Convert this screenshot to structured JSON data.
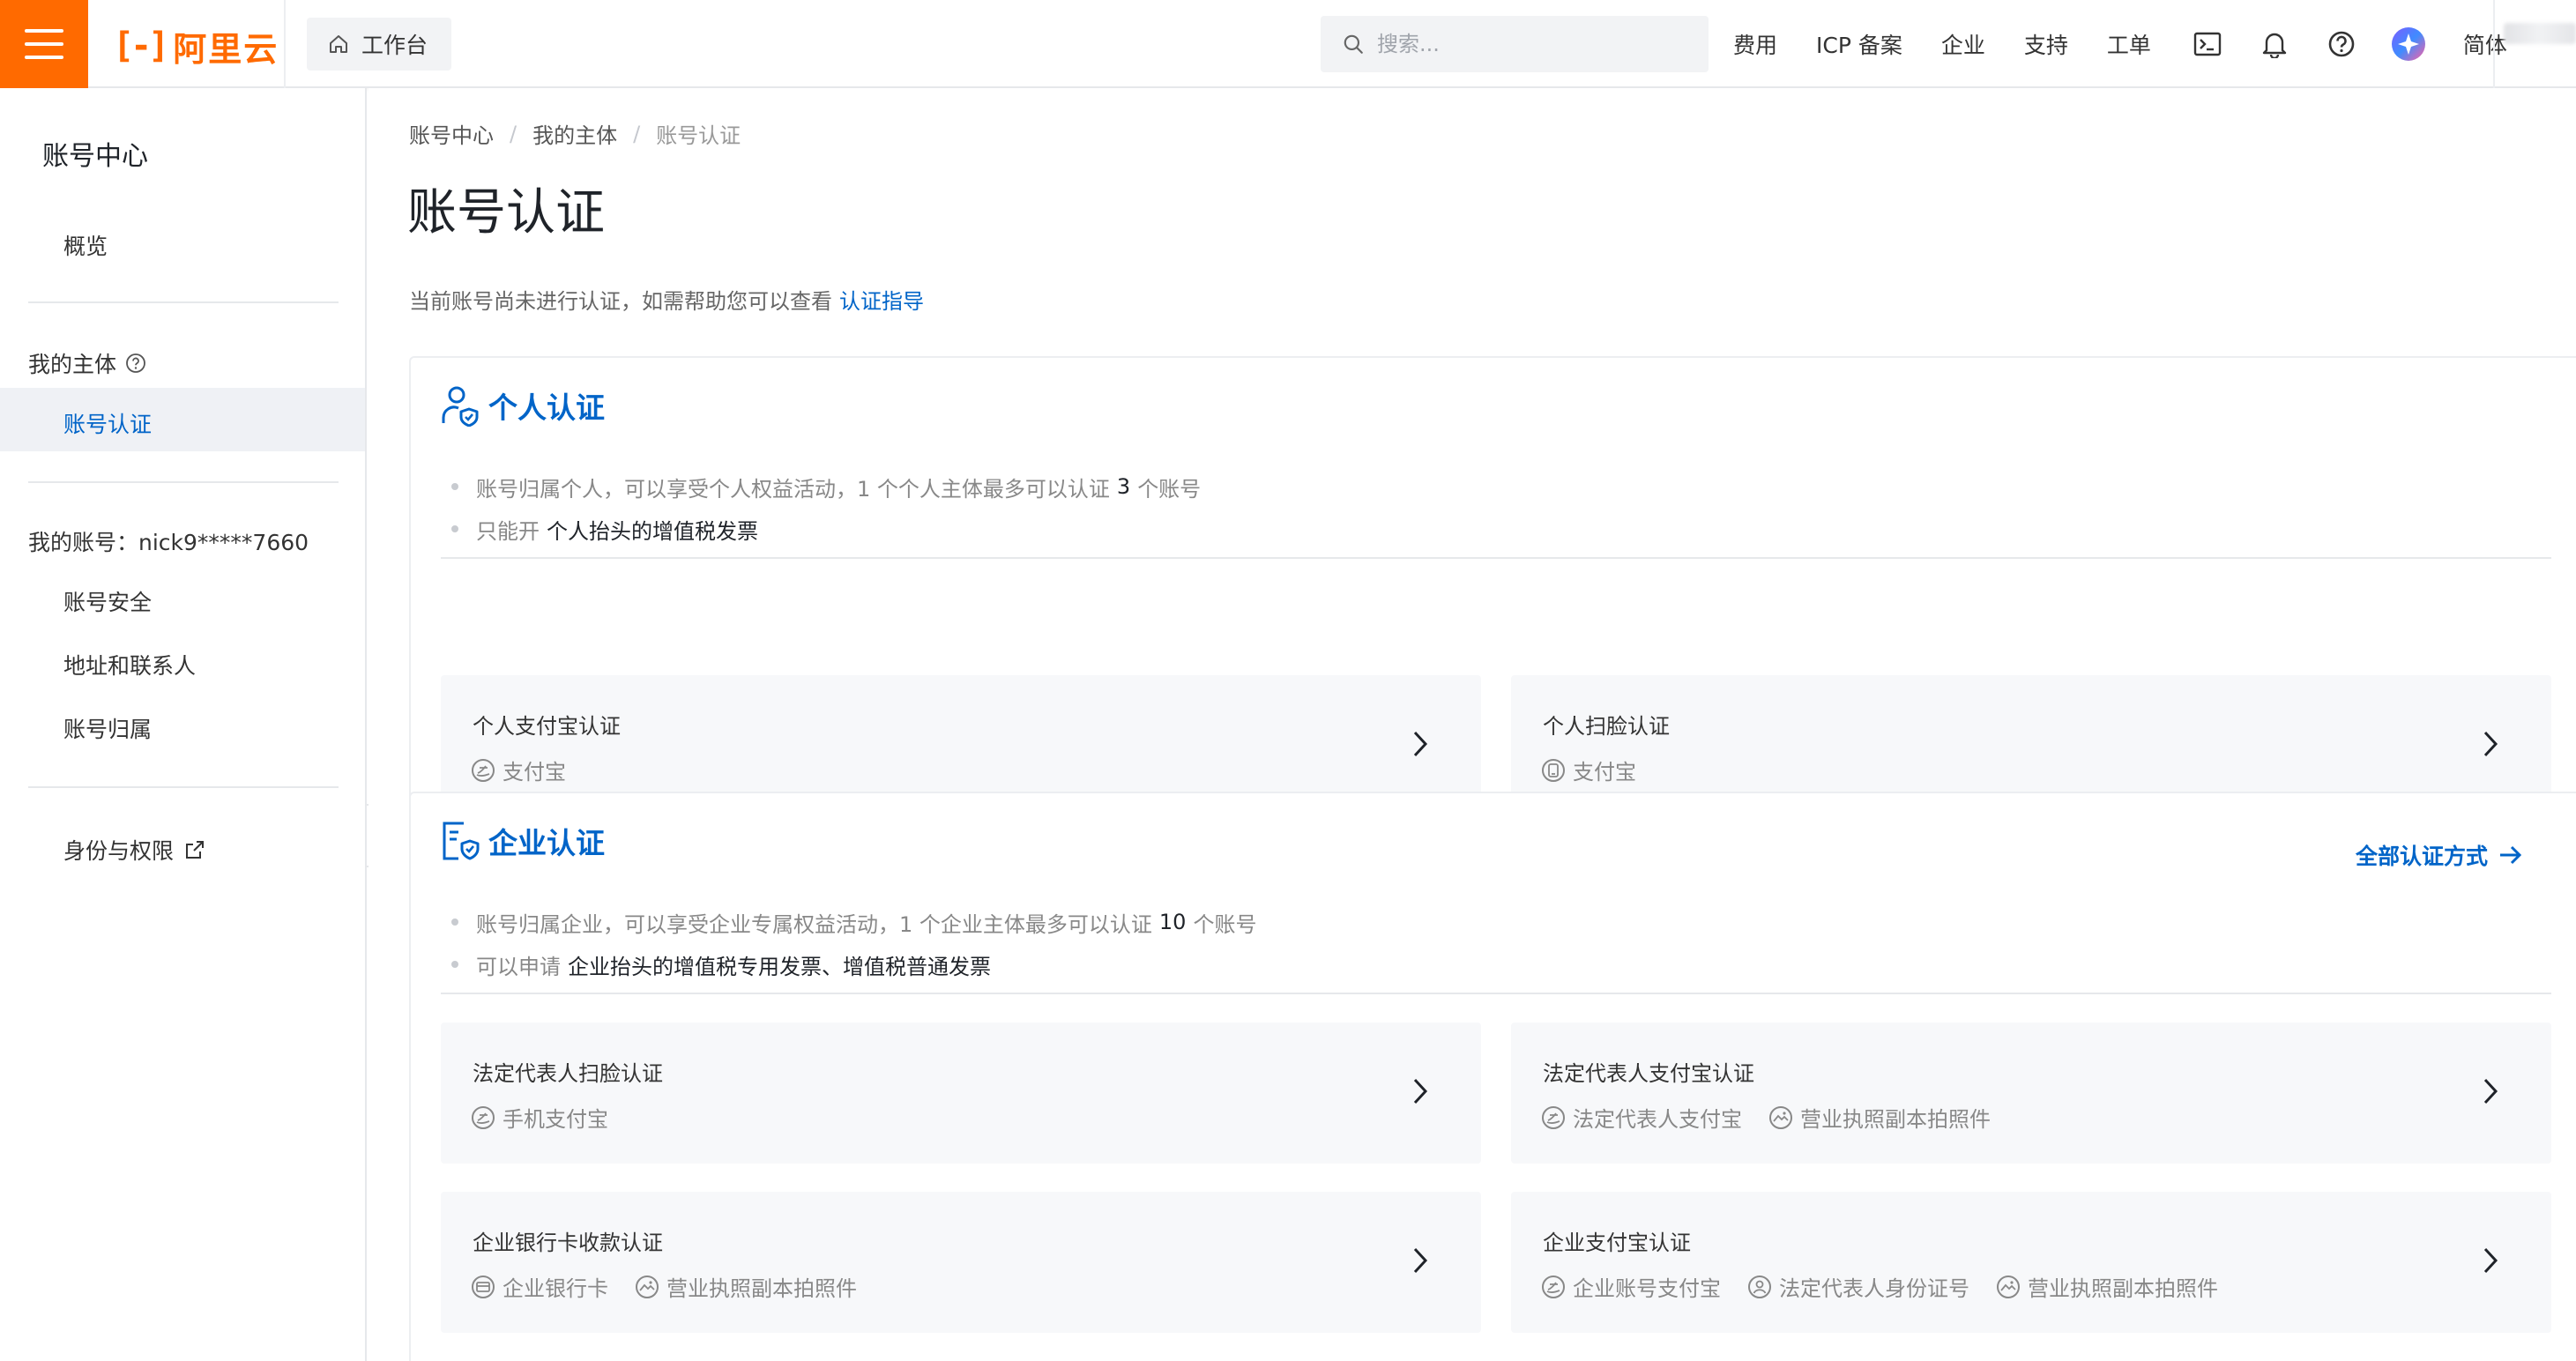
{
  "brand": {
    "logo_mark": "[-]",
    "logo_text": "阿里云",
    "accent": "#ff6a00"
  },
  "header": {
    "workbench_label": "工作台",
    "search_placeholder": "搜索...",
    "nav": [
      "费用",
      "ICP 备案",
      "企业",
      "支持",
      "工单"
    ],
    "lang": "简体",
    "icons": [
      "terminal-icon",
      "bell-icon",
      "help-icon",
      "avatar-icon"
    ]
  },
  "sidebar": {
    "title": "账号中心",
    "overview": "概览",
    "entity_group": "我的主体",
    "active_item": "账号认证",
    "account_group": "我的账号：nick9*****7660",
    "account_items": [
      "账号安全",
      "地址和联系人",
      "账号归属"
    ],
    "identity_item": "身份与权限"
  },
  "breadcrumb": [
    "账号中心",
    "我的主体",
    "账号认证"
  ],
  "page": {
    "title": "账号认证",
    "desc": "当前账号尚未进行认证，如需帮助您可以查看",
    "guide_link": "认证指导"
  },
  "personal": {
    "title": "个人认证",
    "bullet1_pre": "账号归属个人，可以享受个人权益活动，1 个个人主体最多可以认证",
    "bullet1_num": "3",
    "bullet1_post": "个账号",
    "bullet2_pre": "只能开",
    "bullet2_strong": "个人抬头的增值税发票",
    "options": [
      {
        "title": "个人支付宝认证",
        "tags": [
          "支付宝"
        ]
      },
      {
        "title": "个人扫脸认证",
        "tags": [
          "支付宝"
        ]
      }
    ]
  },
  "enterprise": {
    "title": "企业认证",
    "all_methods": "全部认证方式",
    "bullet1_pre": "账号归属企业，可以享受企业专属权益活动，1 个企业主体最多可以认证",
    "bullet1_num": "10",
    "bullet1_post": "个账号",
    "bullet2_pre": "可以申请",
    "bullet2_strong": "企业抬头的增值税专用发票、增值税普通发票",
    "options": [
      {
        "title": "法定代表人扫脸认证",
        "tags": [
          "手机支付宝"
        ]
      },
      {
        "title": "法定代表人支付宝认证",
        "tags": [
          "法定代表人支付宝",
          "营业执照副本拍照件"
        ]
      },
      {
        "title": "企业银行卡收款认证",
        "tags": [
          "企业银行卡",
          "营业执照副本拍照件"
        ]
      },
      {
        "title": "企业支付宝认证",
        "tags": [
          "企业账号支付宝",
          "法定代表人身份证号",
          "营业执照副本拍照件"
        ]
      }
    ]
  },
  "colors": {
    "link": "#0064c8",
    "text": "#1f2329",
    "muted": "#888888"
  }
}
